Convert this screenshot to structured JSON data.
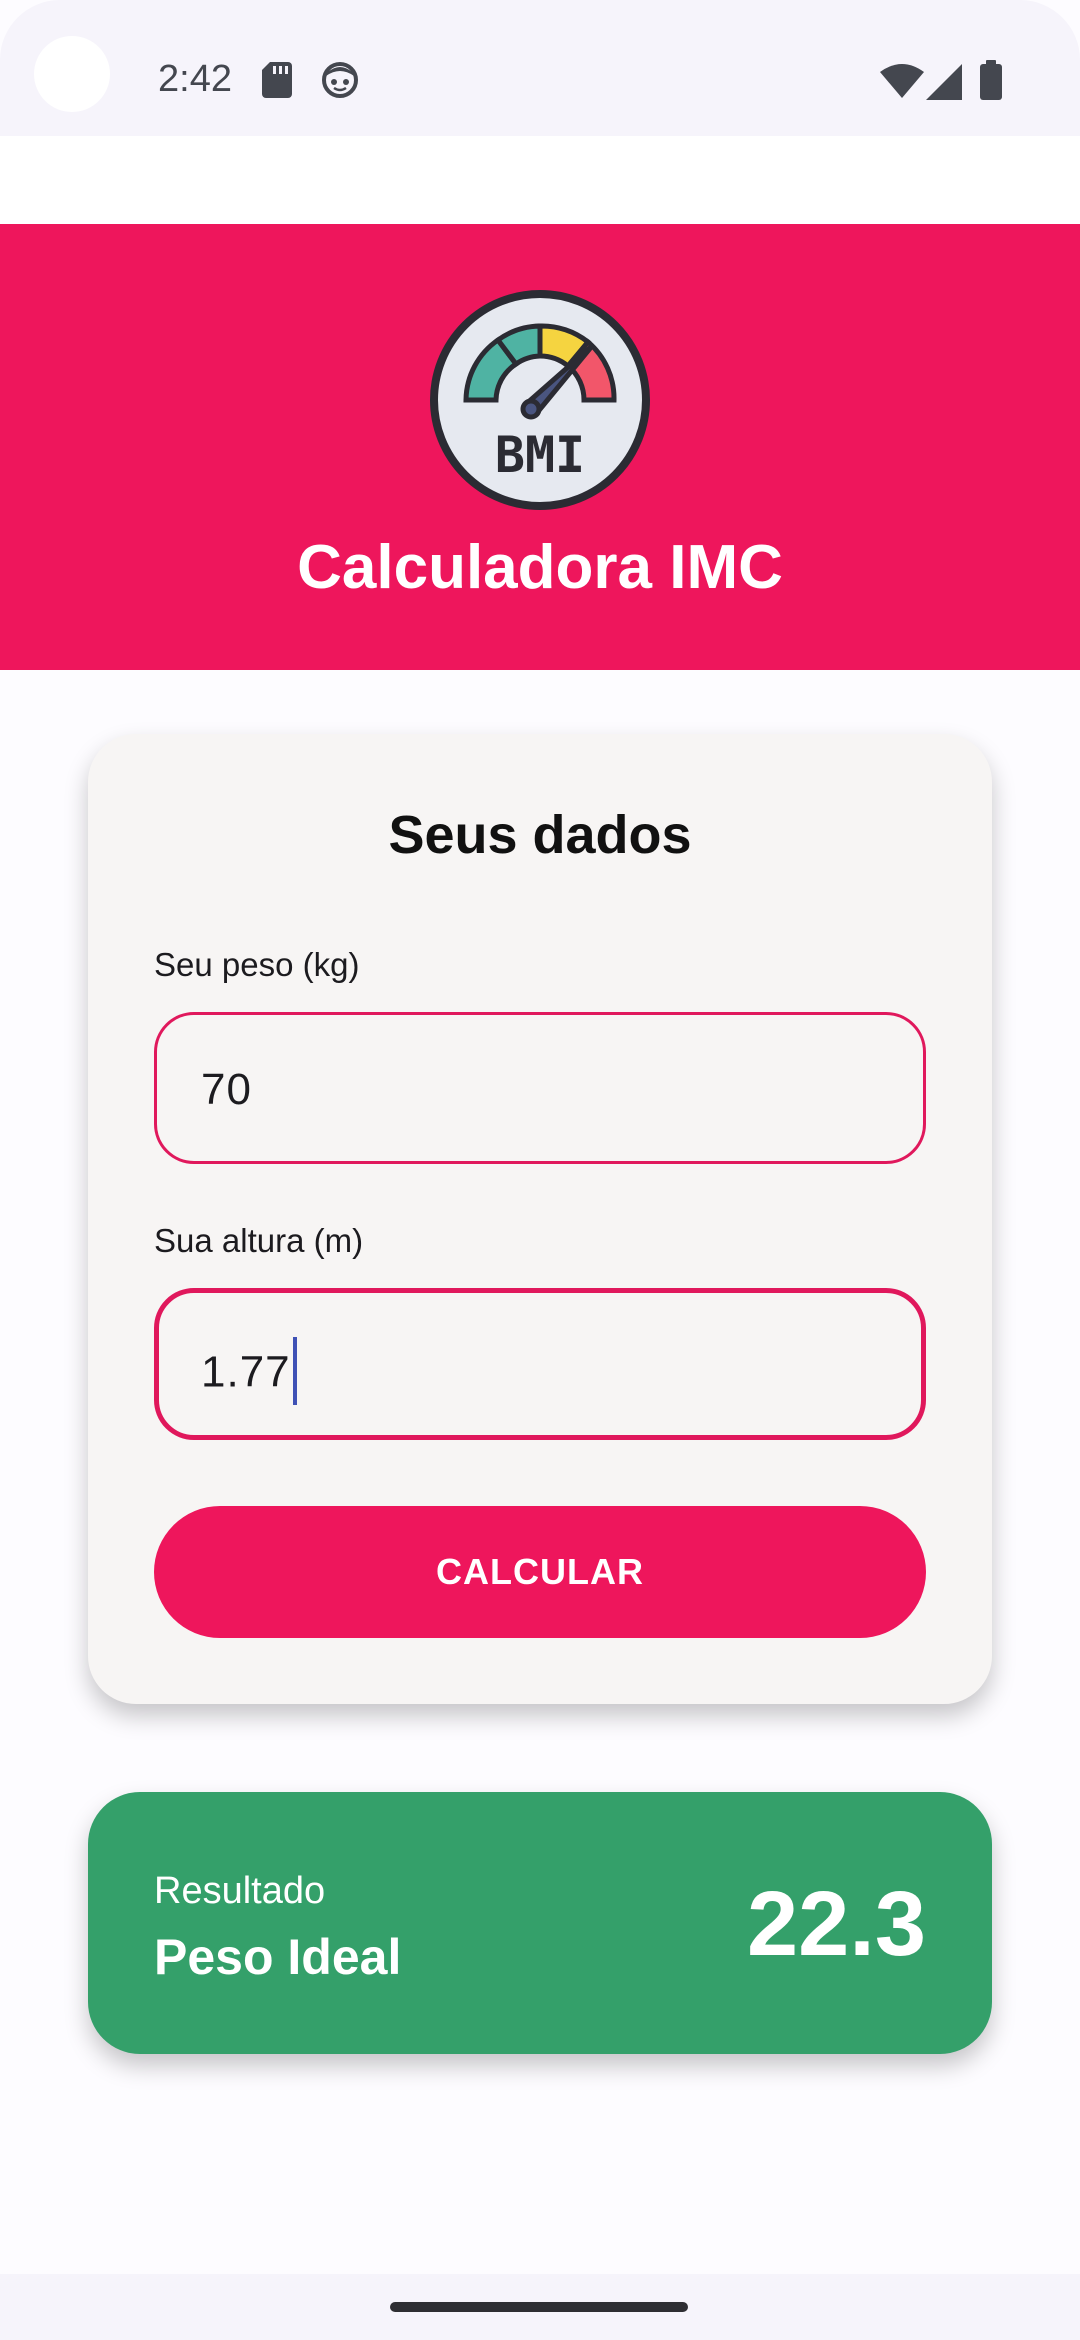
{
  "status_bar": {
    "time": "2:42",
    "icons": [
      "sd-card-icon",
      "face-icon",
      "wifi-icon",
      "signal-icon",
      "battery-icon"
    ]
  },
  "header": {
    "title": "Calculadora IMC",
    "logo_text": "BMI",
    "background_color": "#ee165c"
  },
  "form": {
    "title": "Seus dados",
    "weight_label": "Seu peso (kg)",
    "weight_value": "70",
    "height_label": "Sua altura (m)",
    "height_value": "1.77",
    "submit_label": "CALCULAR"
  },
  "result": {
    "label": "Resultado",
    "status": "Peso Ideal",
    "value": "22.3",
    "color": "#34a06a"
  }
}
